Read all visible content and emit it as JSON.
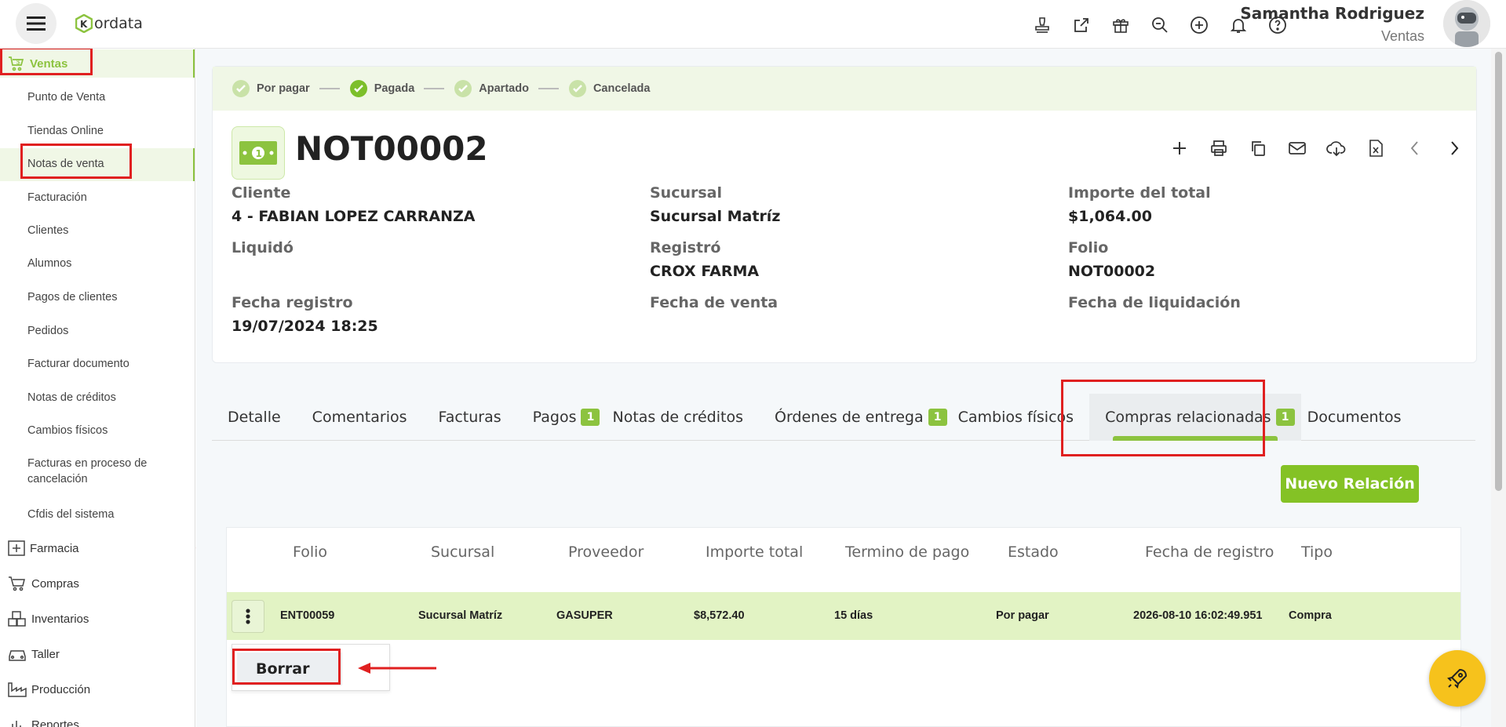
{
  "header": {
    "brand": "ordata",
    "user_name": "Samantha Rodriguez",
    "user_role": "Ventas",
    "icons": [
      "stamp-icon",
      "external-link-icon",
      "gift-icon",
      "search-zoom-icon",
      "add-circle-icon",
      "bell-icon",
      "help-icon"
    ]
  },
  "colors": {
    "accent": "#84c225",
    "accent_light": "#e2f3c4",
    "highlight": "#e02020",
    "fab": "#f6c21c"
  },
  "sidebar": {
    "ventas": "Ventas",
    "items": [
      "Punto de Venta",
      "Tiendas Online",
      "Notas de venta",
      "Facturación",
      "Clientes",
      "Alumnos",
      "Pagos de clientes",
      "Pedidos",
      "Facturar documento",
      "Notas de créditos",
      "Cambios físicos",
      "Facturas en proceso de cancelación",
      "Cfdis del sistema"
    ],
    "sections": [
      "Farmacia",
      "Compras",
      "Inventarios",
      "Taller",
      "Producción",
      "Reportes"
    ]
  },
  "status_steps": [
    "Por pagar",
    "Pagada",
    "Apartado",
    "Cancelada"
  ],
  "note": {
    "title": "NOT00002",
    "fields": {
      "cliente_label": "Cliente",
      "cliente_value": "4 - FABIAN LOPEZ CARRANZA",
      "sucursal_label": "Sucursal",
      "sucursal_value": "Sucursal Matríz",
      "importe_label": "Importe del total",
      "importe_value": "$1,064.00",
      "liquido_label": "Liquidó",
      "registro_label": "Registró",
      "registro_value": "CROX FARMA",
      "folio_label": "Folio",
      "folio_value": "NOT00002",
      "fecha_registro_label": "Fecha registro",
      "fecha_registro_value": "19/07/2024 18:25",
      "fecha_venta_label": "Fecha de venta",
      "fecha_liquidacion_label": "Fecha de liquidación"
    }
  },
  "tabs": {
    "detalle": "Detalle",
    "comentarios": "Comentarios",
    "facturas": "Facturas",
    "pagos": "Pagos",
    "pagos_count": "1",
    "notas_creditos": "Notas de créditos",
    "ordenes": "Órdenes de entrega",
    "ordenes_count": "1",
    "cambios": "Cambios físicos",
    "compras": "Compras relacionadas",
    "compras_count": "1",
    "documentos": "Documentos"
  },
  "new_button": "Nuevo Relación",
  "table": {
    "headers": {
      "folio": "Folio",
      "sucursal": "Sucursal",
      "proveedor": "Proveedor",
      "importe": "Importe total",
      "termino": "Termino de pago",
      "estado": "Estado",
      "fecha": "Fecha de registro",
      "tipo": "Tipo"
    },
    "row": {
      "folio": "ENT00059",
      "sucursal": "Sucursal Matríz",
      "proveedor": "GASUPER",
      "importe": "$8,572.40",
      "termino": "15 días",
      "estado": "Por pagar",
      "fecha": "2026-08-10 16:02:49.951",
      "tipo": "Compra"
    }
  },
  "context_menu": {
    "delete": "Borrar"
  }
}
